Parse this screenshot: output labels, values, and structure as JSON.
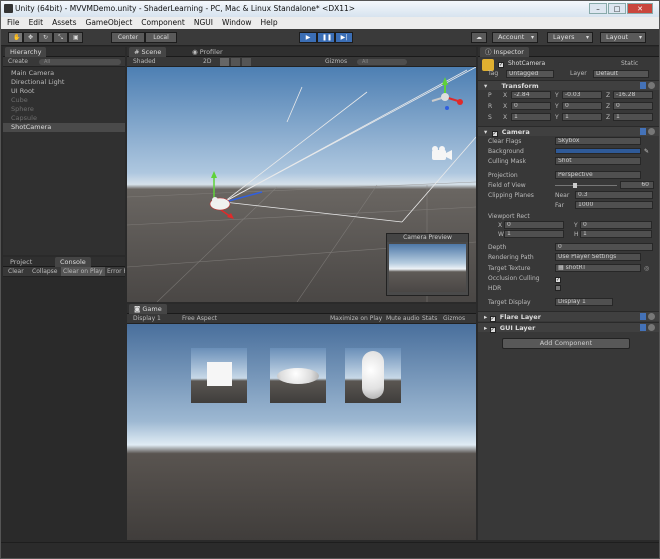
{
  "window": {
    "title": "Unity (64bit) - MVVMDemo.unity - ShaderLearning - PC, Mac & Linux Standalone* <DX11>"
  },
  "menu": [
    "File",
    "Edit",
    "Assets",
    "GameObject",
    "Component",
    "NGUI",
    "Window",
    "Help"
  ],
  "toolbar": {
    "pivot": "Center",
    "space": "Local",
    "account": "Account",
    "layers": "Layers",
    "layout": "Layout"
  },
  "hierarchy": {
    "tab": "Hierarchy",
    "create": "Create",
    "search_placeholder": "All",
    "items": [
      {
        "label": "Main Camera",
        "dim": false
      },
      {
        "label": "Directional Light",
        "dim": false
      },
      {
        "label": "UI Root",
        "dim": false
      },
      {
        "label": "Cube",
        "dim": true
      },
      {
        "label": "Sphere",
        "dim": true
      },
      {
        "label": "Capsule",
        "dim": true
      },
      {
        "label": "ShotCamera",
        "dim": false,
        "selected": true
      }
    ]
  },
  "console": {
    "tabs": [
      "Project",
      "Console"
    ],
    "buttons": [
      "Clear",
      "Collapse",
      "Clear on Play",
      "Error P"
    ]
  },
  "scene": {
    "tabs": [
      "Scene",
      "Profiler"
    ],
    "shading": "Shaded",
    "mode": "2D",
    "gizmos": "Gizmos",
    "search_placeholder": "All",
    "camera_preview": "Camera Preview"
  },
  "game": {
    "tab": "Game",
    "display": "Display 1",
    "aspect": "Free Aspect",
    "maximize": "Maximize on Play",
    "mute": "Mute audio",
    "stats": "Stats",
    "gizmos": "Gizmos"
  },
  "inspector": {
    "tab": "Inspector",
    "object_name": "ShotCamera",
    "static": "Static",
    "tag_label": "Tag",
    "tag": "Untagged",
    "layer_label": "Layer",
    "layer": "Default",
    "transform": {
      "title": "Transform",
      "position": {
        "label": "P",
        "x": "-2.84",
        "y": "-0.03",
        "z": "-16.28"
      },
      "rotation": {
        "label": "R",
        "x": "0",
        "y": "0",
        "z": "0"
      },
      "scale": {
        "label": "S",
        "x": "1",
        "y": "1",
        "z": "1"
      }
    },
    "camera": {
      "title": "Camera",
      "clear_flags": {
        "label": "Clear Flags",
        "value": "Skybox"
      },
      "background": {
        "label": "Background"
      },
      "culling_mask": {
        "label": "Culling Mask",
        "value": "Shot"
      },
      "projection": {
        "label": "Projection",
        "value": "Perspective"
      },
      "fov": {
        "label": "Field of View",
        "value": "60"
      },
      "clipping": {
        "label": "Clipping Planes",
        "near_label": "Near",
        "near": "0.3",
        "far_label": "Far",
        "far": "1000"
      },
      "viewport": {
        "label": "Viewport Rect",
        "x": "0",
        "y": "0",
        "w": "1",
        "h": "1"
      },
      "depth": {
        "label": "Depth",
        "value": "0"
      },
      "rendering_path": {
        "label": "Rendering Path",
        "value": "Use Player Settings"
      },
      "target_texture": {
        "label": "Target Texture",
        "value": "shotRT"
      },
      "occlusion": {
        "label": "Occlusion Culling"
      },
      "hdr": {
        "label": "HDR"
      },
      "target_display": {
        "label": "Target Display",
        "value": "Display 1"
      }
    },
    "flare_layer": "Flare Layer",
    "gui_layer": "GUI Layer",
    "add_component": "Add Component"
  }
}
